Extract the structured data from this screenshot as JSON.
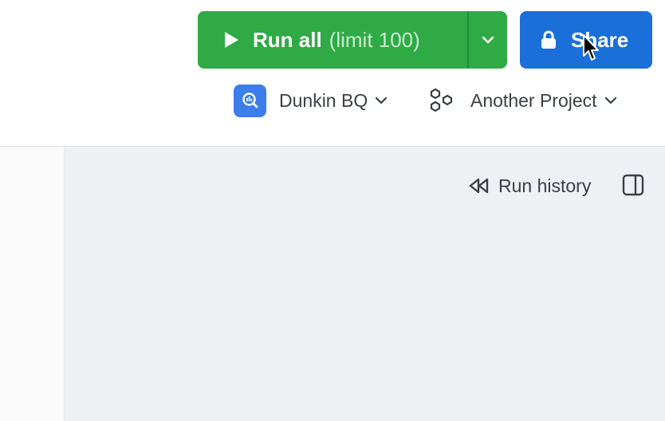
{
  "toolbar": {
    "run_all_label": "Run all",
    "run_all_limit": "(limit 100)",
    "share_label": "Share",
    "connections": [
      {
        "label": "Dunkin BQ",
        "icon": "bigquery-icon"
      },
      {
        "label": "Another Project",
        "icon": "project-icon"
      }
    ]
  },
  "main": {
    "run_history_label": "Run history"
  },
  "colors": {
    "run_green": "#2faa45",
    "share_blue": "#1b6fd8",
    "bq_blue": "#3b7de9",
    "canvas_bg": "#eff0f4"
  }
}
